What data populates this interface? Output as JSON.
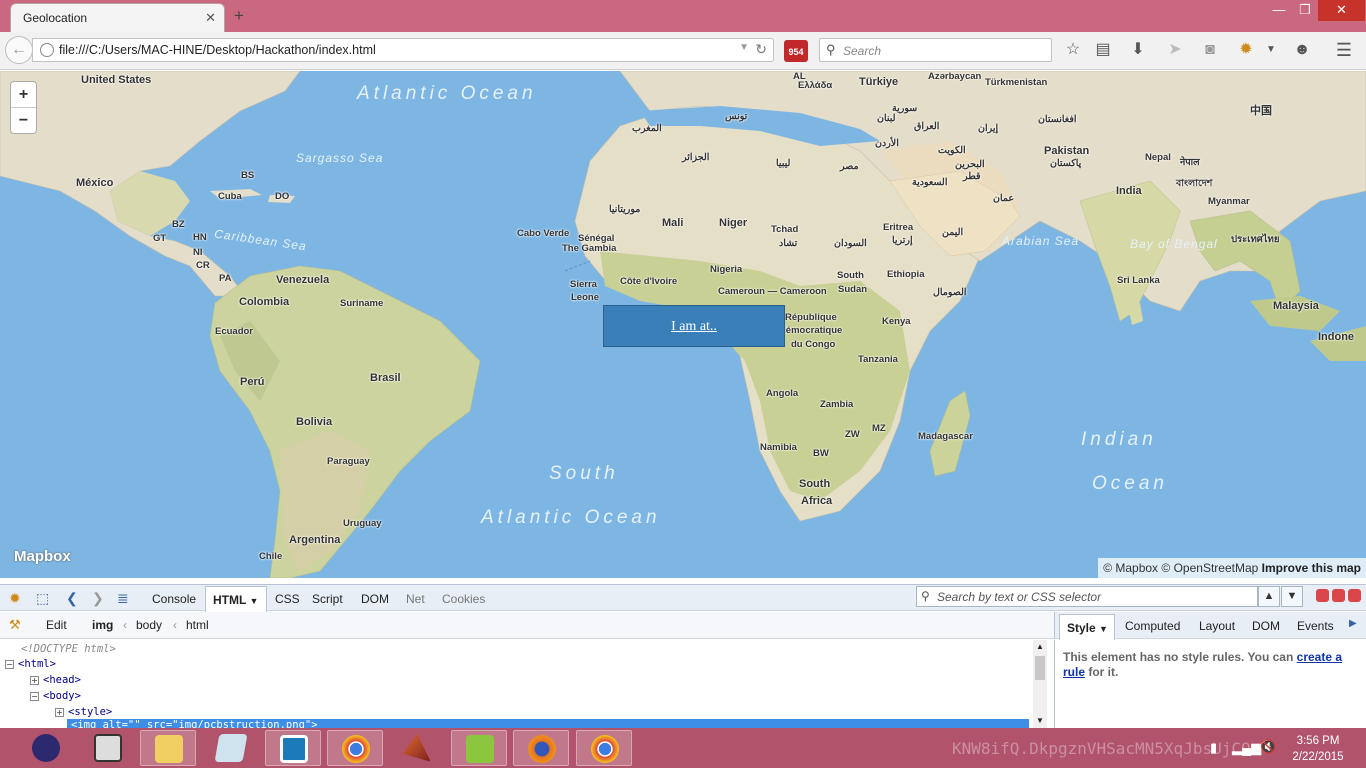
{
  "window": {
    "tab_title": "Geolocation",
    "tab_close": "✕",
    "new_tab": "+",
    "min": "—",
    "max": "❐",
    "close": "✕"
  },
  "navbar": {
    "back": "←",
    "url": "file:///C:/Users/MAC-HINE/Desktop/Hackathon/index.html",
    "addon_badge": "954",
    "search_placeholder": "Search"
  },
  "map": {
    "zoom_in": "+",
    "zoom_out": "−",
    "logo": "Mapbox",
    "attribution": {
      "mapbox": "© Mapbox",
      "osm": "© OpenStreetMap",
      "improve": "Improve this map"
    },
    "popup_link": "I am at..",
    "oceans": [
      {
        "label": "Atlantic Ocean",
        "name": "atlantic-north"
      },
      {
        "label": "South",
        "name": "atlantic-south-1"
      },
      {
        "label": "Atlantic Ocean",
        "name": "atlantic-south-2"
      },
      {
        "label": "Indian",
        "name": "indian-1"
      },
      {
        "label": "Ocean",
        "name": "indian-2"
      }
    ],
    "seas": [
      "Sargasso Sea",
      "Caribbean Sea",
      "Arabian Sea",
      "Bay of Bengal"
    ],
    "labels": [
      "United States",
      "México",
      "BS",
      "Cuba",
      "DO",
      "BZ",
      "HN",
      "GT",
      "NI",
      "CR",
      "PA",
      "Venezuela",
      "Colombia",
      "Suriname",
      "Ecuador",
      "Perú",
      "Brasil",
      "Bolivia",
      "Paraguay",
      "Uruguay",
      "Argentina",
      "Chile",
      "Cabo Verde",
      "Sénégal",
      "The Gambia",
      "Sierra",
      "Leone",
      "Côte d'Ivoire",
      "Mali",
      "Niger",
      "Tchad",
      "تشاد",
      "Nigeria",
      "Cameroun — Cameroon",
      "Eritrea",
      "إرتريا",
      "السودان",
      "South",
      "Sudan",
      "Ethiopia",
      "الصومال",
      "République",
      "démocratique",
      "du Congo",
      "Kenya",
      "Tanzania",
      "Angola",
      "Zambia",
      "ZW",
      "MZ",
      "Namibia",
      "BW",
      "South",
      "Africa",
      "Madagascar",
      "المغرب",
      "تونس",
      "الجزائر",
      "ليبيا",
      "مصر",
      "موريتانيا",
      "AL",
      "Ελλάδα",
      "Türkiye",
      "Azərbaycan",
      "Türkmenistan",
      "سورية",
      "لبنان",
      "العراق",
      "الأردن",
      "إيران",
      "الكويت",
      "البحرين",
      "قطر",
      "السعودية",
      "عمان",
      "اليمن",
      "افغانستان",
      "Pakistan",
      "پاکستان",
      "Nepal",
      "नेपाल",
      "India",
      "বাংলাদেশ",
      "Myanmar",
      "ประเทศไทย",
      "Sri Lanka",
      "Malaysia",
      "Indone",
      "中国"
    ]
  },
  "firebug": {
    "tabs": [
      "Console",
      "HTML",
      "CSS",
      "Script",
      "DOM",
      "Net",
      "Cookies"
    ],
    "search_placeholder": "Search by text or CSS selector",
    "edit": "Edit",
    "breadcrumb": [
      "img",
      "body",
      "html"
    ],
    "side_tabs": [
      "Style",
      "Computed",
      "Layout",
      "DOM",
      "Events"
    ],
    "style_msg_1": "This element has no style rules. You can ",
    "style_msg_link": "create a rule",
    "style_msg_2": " for it.",
    "tree": [
      "<!DOCTYPE html>",
      "<html>",
      "<head>",
      "<body>",
      "<style>",
      "<img alt=\"\" src=\"img/pcbstruction.png\">"
    ]
  },
  "taskbar": {
    "watermark": "KNW8ifQ.DkpgznVHSacMN5XqJbsUjCO",
    "time": "3:56 PM",
    "date": "2/22/2015",
    "apps": [
      "eclipse",
      "media-player-classic",
      "file-explorer",
      "notepad",
      "sublime-like",
      "chrome",
      "matlab",
      "pea-app",
      "firefox",
      "chrome-2"
    ]
  }
}
